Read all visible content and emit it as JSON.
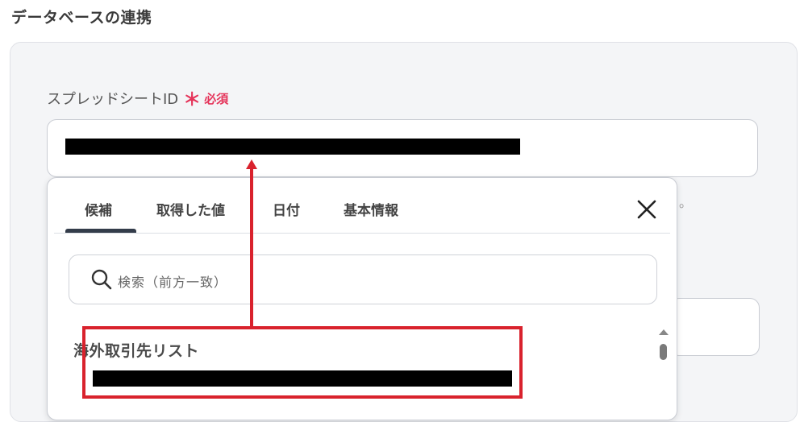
{
  "section": {
    "title": "データベースの連携"
  },
  "field": {
    "label": "スプレッドシートID",
    "required_mark": "＊",
    "required_text": "必須",
    "value": "[redacted]"
  },
  "background": {
    "trailing_mark": "。"
  },
  "popup": {
    "tabs": [
      {
        "label": "候補",
        "active": true
      },
      {
        "label": "取得した値",
        "active": false
      },
      {
        "label": "日付",
        "active": false
      },
      {
        "label": "基本情報",
        "active": false
      }
    ],
    "close_icon": "close-icon",
    "search": {
      "placeholder": "検索（前方一致）",
      "icon": "search-icon"
    },
    "results": [
      {
        "title": "海外取引先リスト",
        "id": "[redacted]"
      }
    ]
  },
  "annotation": {
    "color": "#d9222d"
  },
  "colors": {
    "accent_required": "#e5345a",
    "tab_indicator": "#333c4a"
  }
}
